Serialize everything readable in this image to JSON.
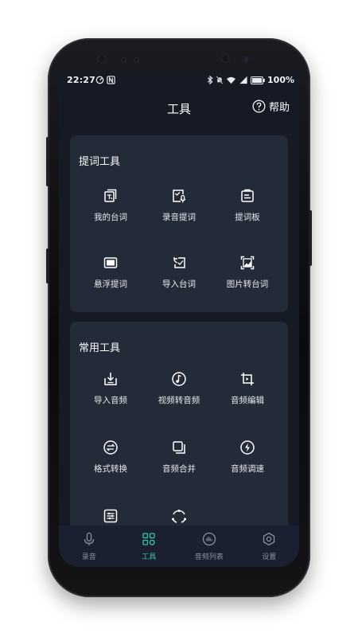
{
  "status_bar": {
    "time": "22:27",
    "battery": "100%",
    "left_icons": [
      "data-speed-icon",
      "nfc-icon"
    ],
    "right_icons": [
      "bluetooth-icon",
      "silent-icon",
      "wifi-icon",
      "signal-icon",
      "battery-icon"
    ]
  },
  "header": {
    "title": "工具",
    "help_label": "帮助"
  },
  "sections": [
    {
      "title": "提词工具",
      "items": [
        {
          "label": "我的台词",
          "icon": "script-icon"
        },
        {
          "label": "录音提词",
          "icon": "record-prompt-icon"
        },
        {
          "label": "提词板",
          "icon": "prompt-board-icon"
        },
        {
          "label": "悬浮提词",
          "icon": "float-prompt-icon"
        },
        {
          "label": "导入台词",
          "icon": "import-script-icon"
        },
        {
          "label": "图片转台词",
          "icon": "image-to-text-icon"
        }
      ]
    },
    {
      "title": "常用工具",
      "items": [
        {
          "label": "导入音频",
          "icon": "import-audio-icon"
        },
        {
          "label": "视频转音频",
          "icon": "video-to-audio-icon"
        },
        {
          "label": "音频编辑",
          "icon": "crop-audio-icon"
        },
        {
          "label": "格式转换",
          "icon": "format-convert-icon"
        },
        {
          "label": "音频合并",
          "icon": "merge-audio-icon"
        },
        {
          "label": "音频调速",
          "icon": "speed-icon"
        },
        {
          "label": "",
          "icon": "equalizer-icon"
        },
        {
          "label": "",
          "icon": "loop-icon"
        }
      ]
    }
  ],
  "tabbar": {
    "active": "工具",
    "tabs": [
      {
        "label": "录音",
        "icon": "microphone-icon"
      },
      {
        "label": "工具",
        "icon": "tools-grid-icon"
      },
      {
        "label": "音频列表",
        "icon": "audio-list-icon"
      },
      {
        "label": "设置",
        "icon": "gear-icon"
      }
    ]
  },
  "colors": {
    "background": "#151a24",
    "card": "#232a38",
    "accent": "#37c79c",
    "text": "#ffffff",
    "tab_inactive": "#8a90a0"
  }
}
